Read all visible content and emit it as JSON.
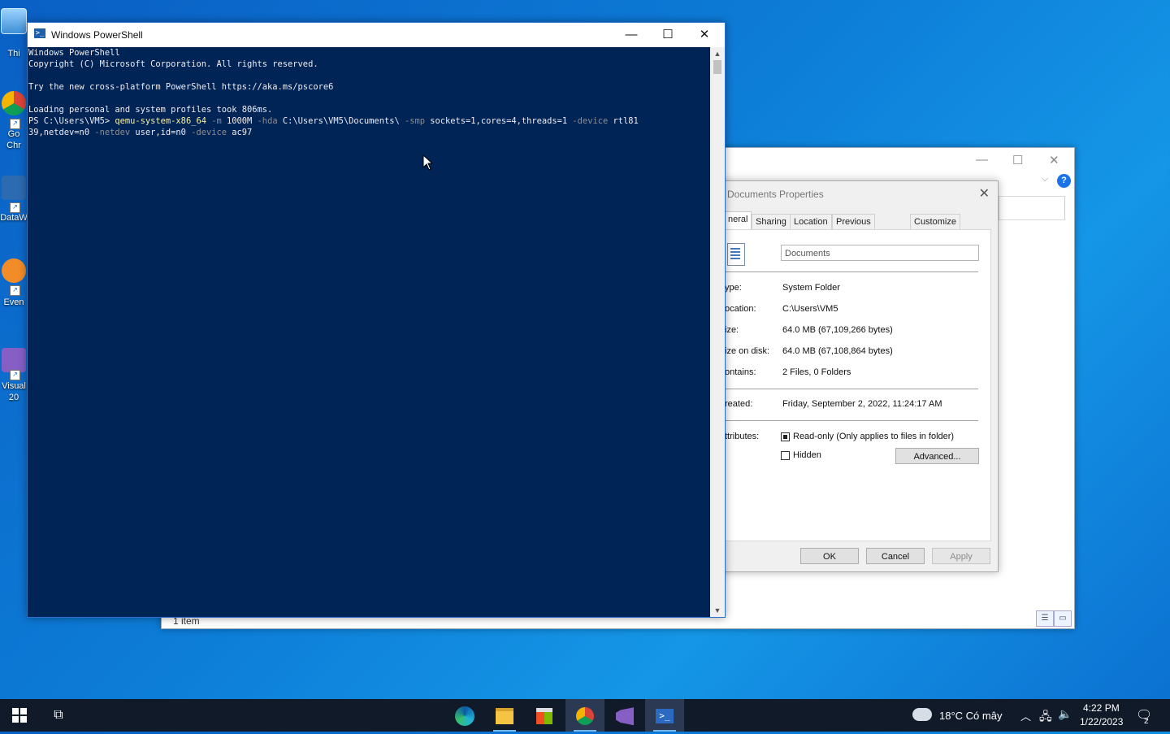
{
  "desktop": {
    "icons": [
      {
        "label": "Thi",
        "name": "this-pc"
      },
      {
        "label": "Go\nChr",
        "name": "google-chrome"
      },
      {
        "label": "DataW",
        "name": "datawrapper"
      },
      {
        "label": "Even",
        "name": "everything"
      },
      {
        "label": "Visual\n20",
        "name": "visual-studio"
      }
    ]
  },
  "explorer": {
    "status": "1 item"
  },
  "properties_dialog": {
    "title": "Documents Properties",
    "tabs": [
      "neral",
      "Sharing",
      "Location",
      "Previous Versions",
      "Customize"
    ],
    "name_value": "Documents",
    "rows": [
      {
        "label": "ype:",
        "value": "System Folder"
      },
      {
        "label": "ocation:",
        "value": "C:\\Users\\VM5"
      },
      {
        "label": "ize:",
        "value": "64.0 MB (67,109,266 bytes)"
      },
      {
        "label": "ize on disk:",
        "value": "64.0 MB (67,108,864 bytes)"
      },
      {
        "label": "ontains:",
        "value": "2 Files, 0 Folders"
      }
    ],
    "created_label": "reated:",
    "created_value": "Friday, September 2, 2022, 11:24:17 AM",
    "attributes_label": "ttributes:",
    "readonly_label": "Read-only (Only applies to files in folder)",
    "readonly_checked": true,
    "hidden_label": "Hidden",
    "hidden_checked": false,
    "advanced_button": "Advanced...",
    "ok_button": "OK",
    "cancel_button": "Cancel",
    "apply_button": "Apply"
  },
  "powershell": {
    "title": "Windows PowerShell",
    "lines": [
      "Windows PowerShell",
      "Copyright (C) Microsoft Corporation. All rights reserved.",
      "",
      "Try the new cross-platform PowerShell https://aka.ms/pscore6",
      "",
      "Loading personal and system profiles took 806ms."
    ],
    "prompt": "PS C:\\Users\\VM5> ",
    "command_parts": [
      {
        "t": "qemu-system-x86_64",
        "k": "cmd"
      },
      {
        "t": " -m",
        "k": "param"
      },
      {
        "t": " 1000M",
        "k": "arg"
      },
      {
        "t": " -hda",
        "k": "param"
      },
      {
        "t": " C:\\Users\\VM5\\Documents\\",
        "k": "arg"
      },
      {
        "t": " -smp",
        "k": "param"
      },
      {
        "t": " sockets=1,cores=4,threads=1",
        "k": "arg"
      },
      {
        "t": " -device",
        "k": "param"
      },
      {
        "t": " rtl81\n39,netdev=n0",
        "k": "arg"
      },
      {
        "t": " -netdev",
        "k": "param"
      },
      {
        "t": " user,id=n0",
        "k": "arg"
      },
      {
        "t": " -device",
        "k": "param"
      },
      {
        "t": " ac97",
        "k": "arg"
      }
    ]
  },
  "taskbar": {
    "weather": "18°C  Có mây",
    "time": "4:22 PM",
    "date": "1/22/2023",
    "notification_count": "2"
  },
  "colors": {
    "console_bg": "#012456",
    "console_fg": "#eeedf0",
    "command": "#f9f1a5",
    "parameter": "#8e8e8e",
    "taskbar": "#101a29"
  }
}
